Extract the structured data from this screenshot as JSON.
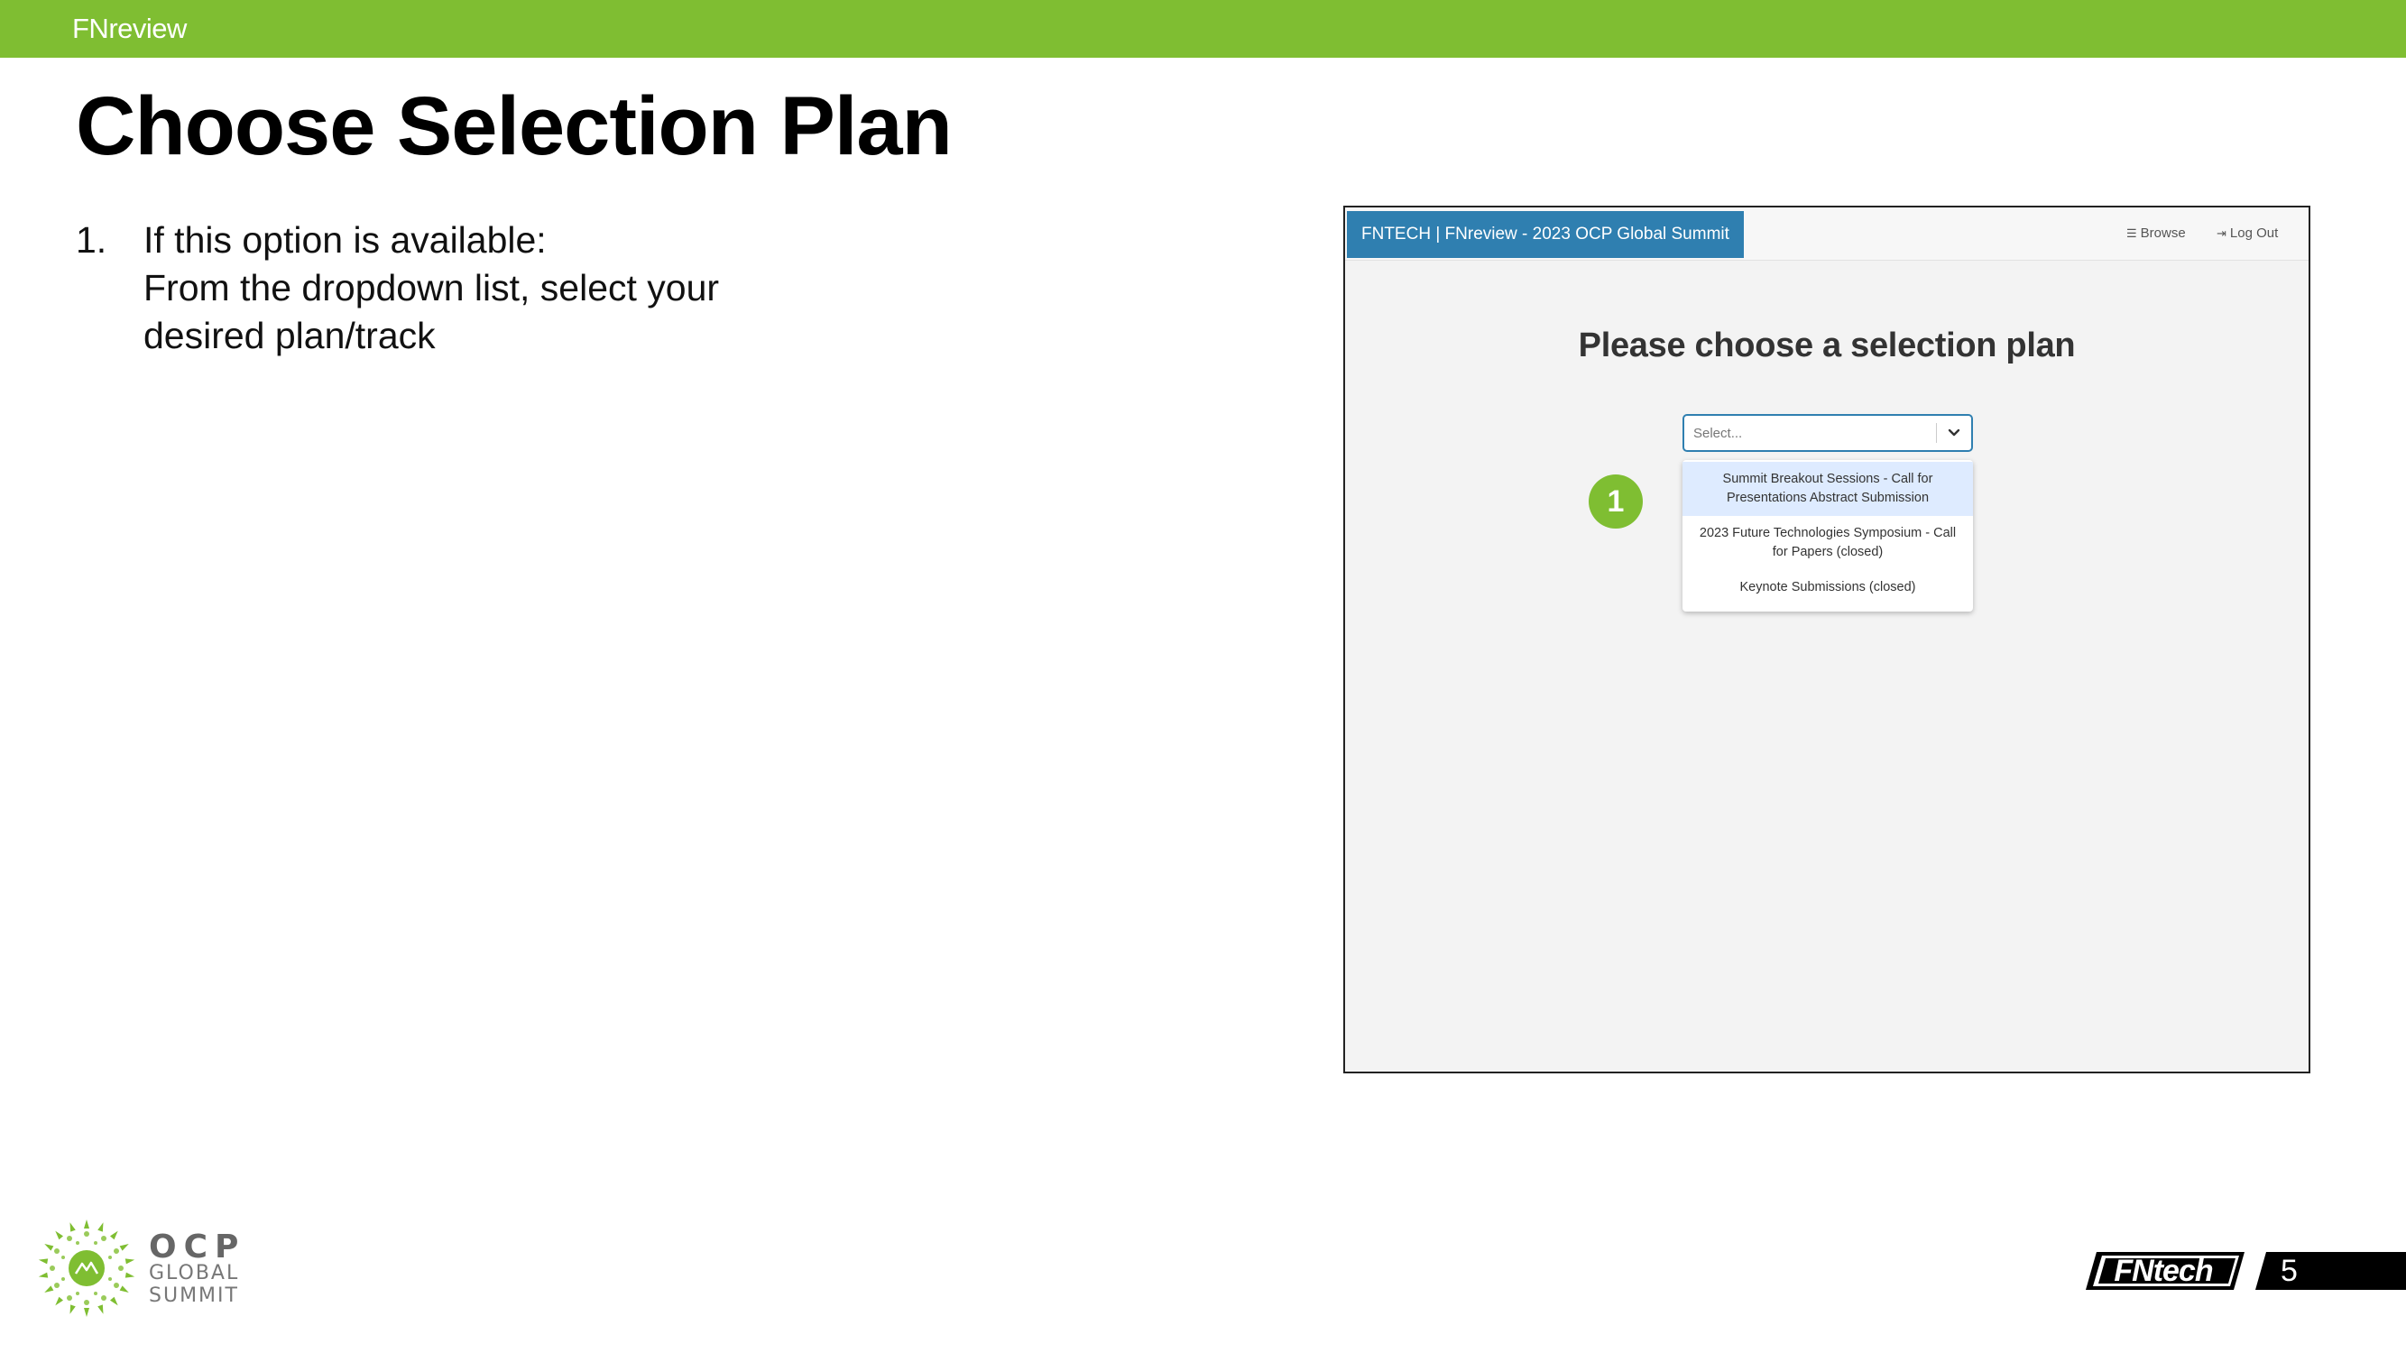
{
  "header": {
    "title": "FNreview",
    "accent_color": "#7fbe32"
  },
  "slide": {
    "title": "Choose Selection Plan",
    "page_number": "5"
  },
  "instructions": [
    {
      "number": "1.",
      "lines": [
        "If this option is available:",
        "From the dropdown list, select your",
        "desired plan/track"
      ]
    }
  ],
  "screenshot": {
    "navbar": {
      "brand": "FNTECH | FNreview - 2023 OCP Global Summit",
      "brand_color": "#2f7fb0",
      "links": [
        {
          "label": "Browse",
          "icon": "list-icon"
        },
        {
          "label": "Log Out",
          "icon": "logout-icon"
        }
      ]
    },
    "heading": "Please choose a selection plan",
    "select": {
      "placeholder": "Select...",
      "icon": "chevron-down-icon"
    },
    "options": [
      {
        "lines": [
          "Summit Breakout Sessions - Call for",
          "Presentations Abstract Submission"
        ],
        "highlighted": true
      },
      {
        "lines": [
          "2023 Future Technologies Symposium - Call",
          "for Papers (closed)"
        ],
        "highlighted": false
      },
      {
        "lines": [
          "Keynote Submissions (closed)"
        ],
        "highlighted": false
      }
    ],
    "callout_badge": "1"
  },
  "footer": {
    "logo": {
      "word": "OCP",
      "line1": "GLOBAL",
      "line2": "SUMMIT"
    },
    "brand_logo": "FNtech"
  }
}
